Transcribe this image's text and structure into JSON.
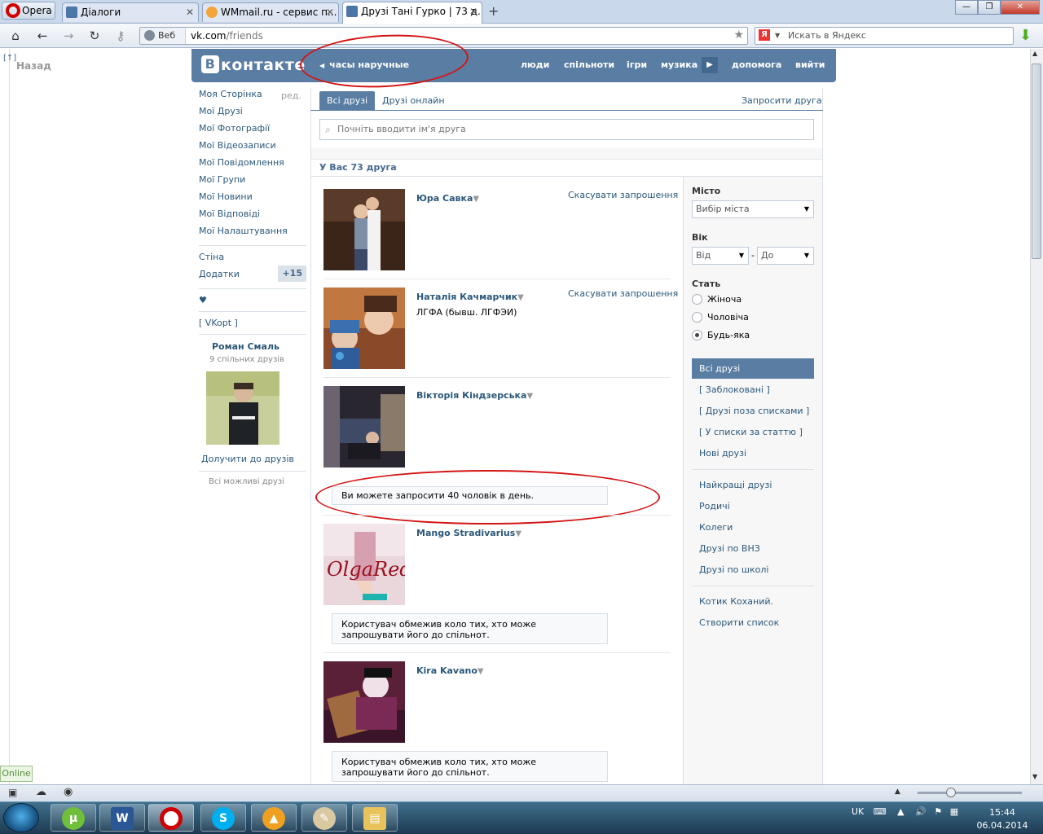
{
  "browser": {
    "menu_label": "Opera",
    "tabs": [
      {
        "title": "Діалоги"
      },
      {
        "title": "WMmail.ru - сервис п..."
      },
      {
        "title": "Друзі Тані Гурко | 73 д..."
      }
    ],
    "web_label": "Веб",
    "address_host": "vk.com",
    "address_path": "/friends",
    "search_placeholder": "Искать в Яндекс",
    "status_online": "Online"
  },
  "vk": {
    "back_label": "Назад",
    "back_arrow": "[↑]",
    "logo_b": "В",
    "logo_text": "контакте",
    "header_status": "часы наручные",
    "top_nav": [
      "люди",
      "спільноти",
      "ігри",
      "музика",
      "допомога",
      "вийти"
    ],
    "left_menu": [
      "Моя Сторінка",
      "Мої Друзі",
      "Мої Фотографії",
      "Мої Відеозаписи",
      "Мої Повідомлення",
      "Мої Групи",
      "Мої Новини",
      "Мої Відповіді",
      "Мої Налаштування"
    ],
    "edit_label": "ред.",
    "wall_label": "Стіна",
    "apps_label": "Додатки",
    "apps_count": "+15",
    "heart": "♥",
    "vkopt": "[ VKopt ]",
    "suggestion": {
      "name": "Роман Смаль",
      "common": "9 спільних друзів",
      "add": "Долучити до друзів",
      "all": "Всі можливі друзі"
    },
    "tabs": {
      "all": "Всі друзі",
      "online": "Друзі онлайн",
      "invite": "Запросити друга"
    },
    "search_placeholder": "Почніть вводити ім'я друга",
    "friends_count": "У Вас 73 друга",
    "friends": [
      {
        "name": "Юра Савка",
        "sub": "",
        "action": "Скасувати запрошення",
        "notice": ""
      },
      {
        "name": "Наталія Качмарчик",
        "sub": "ЛГФА (бывш. ЛГФЭИ)",
        "action": "Скасувати запрошення",
        "notice": ""
      },
      {
        "name": "Вікторія Кіндзерська",
        "sub": "",
        "action": "",
        "notice": "Ви можете запросити 40 чоловік в день."
      },
      {
        "name": "Mango Stradivarius",
        "sub": "",
        "action": "",
        "notice": "Користувач обмежив коло тих, хто може запрошувати його до спільнот."
      },
      {
        "name": "Kira Kavano",
        "sub": "",
        "action": "",
        "notice": "Користувач обмежив коло тих, хто може запрошувати його до спільнот."
      }
    ],
    "filters": {
      "city_label": "Місто",
      "city_value": "Вибір міста",
      "age_label": "Вік",
      "age_from": "Від",
      "age_dash": "-",
      "age_to": "До",
      "gender_label": "Стать",
      "gender_options": [
        "Жіноча",
        "Чоловіча",
        "Будь-яка"
      ],
      "gender_selected": "Будь-яка",
      "lists_selected": "Всі друзі",
      "lists": [
        "[ Заблоковані ]",
        "[ Друзі поза списками ]",
        "[ У списки за статтю ]",
        "Нові друзі"
      ],
      "groups": [
        "Найкращі друзі",
        "Родичі",
        "Колеги",
        "Друзі по ВНЗ",
        "Друзі по школі"
      ],
      "extra": [
        "Котик Коханий.",
        "Створити список"
      ]
    }
  },
  "taskbar": {
    "lang": "UK",
    "time": "15:44",
    "date": "06.04.2014"
  },
  "colors": {
    "vk_blue": "#597da3",
    "link": "#2b587a",
    "annotation_red": "#d41414"
  }
}
